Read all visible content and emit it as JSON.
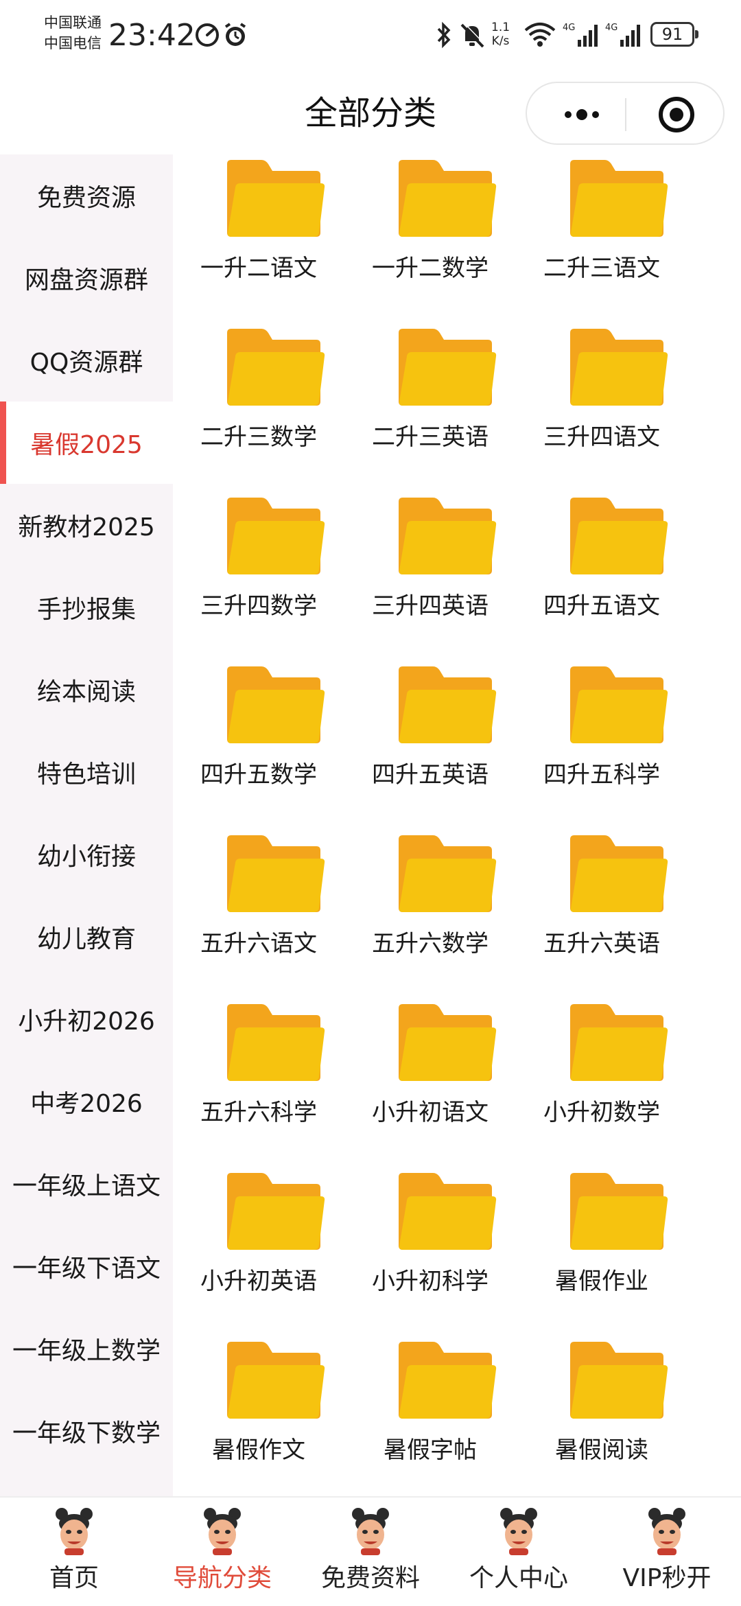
{
  "status": {
    "carrier1": "中国联通",
    "carrier2": "中国电信",
    "time": "23:42",
    "speed_top": "1.1",
    "speed_bottom": "K/s",
    "net1": "4G",
    "net2": "4G",
    "battery": "91"
  },
  "header": {
    "title": "全部分类"
  },
  "colors": {
    "accent": "#d9382f",
    "indicator": "#ef5350",
    "folder_front": "#f6c30f",
    "folder_back": "#f3a51c",
    "sidebar_bg": "#f8f4f7"
  },
  "sidebar": {
    "items": [
      {
        "label": "免费资源"
      },
      {
        "label": "网盘资源群"
      },
      {
        "label": "QQ资源群"
      },
      {
        "label": "暑假2025",
        "active": true
      },
      {
        "label": "新教材2025"
      },
      {
        "label": "手抄报集"
      },
      {
        "label": "绘本阅读"
      },
      {
        "label": "特色培训"
      },
      {
        "label": "幼小衔接"
      },
      {
        "label": "幼儿教育"
      },
      {
        "label": "小升初2026"
      },
      {
        "label": "中考2026"
      },
      {
        "label": "一年级上语文"
      },
      {
        "label": "一年级下语文"
      },
      {
        "label": "一年级上数学"
      },
      {
        "label": "一年级下数学"
      }
    ]
  },
  "grid": {
    "icon": "folder-icon",
    "items": [
      {
        "label": "一升二语文"
      },
      {
        "label": "一升二数学"
      },
      {
        "label": "二升三语文"
      },
      {
        "label": "二升三数学"
      },
      {
        "label": "二升三英语"
      },
      {
        "label": "三升四语文"
      },
      {
        "label": "三升四数学"
      },
      {
        "label": "三升四英语"
      },
      {
        "label": "四升五语文"
      },
      {
        "label": "四升五数学"
      },
      {
        "label": "四升五英语"
      },
      {
        "label": "四升五科学"
      },
      {
        "label": "五升六语文"
      },
      {
        "label": "五升六数学"
      },
      {
        "label": "五升六英语"
      },
      {
        "label": "五升六科学"
      },
      {
        "label": "小升初语文"
      },
      {
        "label": "小升初数学"
      },
      {
        "label": "小升初英语"
      },
      {
        "label": "小升初科学"
      },
      {
        "label": "暑假作业"
      },
      {
        "label": "暑假作文"
      },
      {
        "label": "暑假字帖"
      },
      {
        "label": "暑假阅读"
      }
    ]
  },
  "tabbar": {
    "items": [
      {
        "label": "首页"
      },
      {
        "label": "导航分类",
        "active": true
      },
      {
        "label": "免费资料"
      },
      {
        "label": "个人中心"
      },
      {
        "label": "VIP秒开"
      }
    ]
  }
}
